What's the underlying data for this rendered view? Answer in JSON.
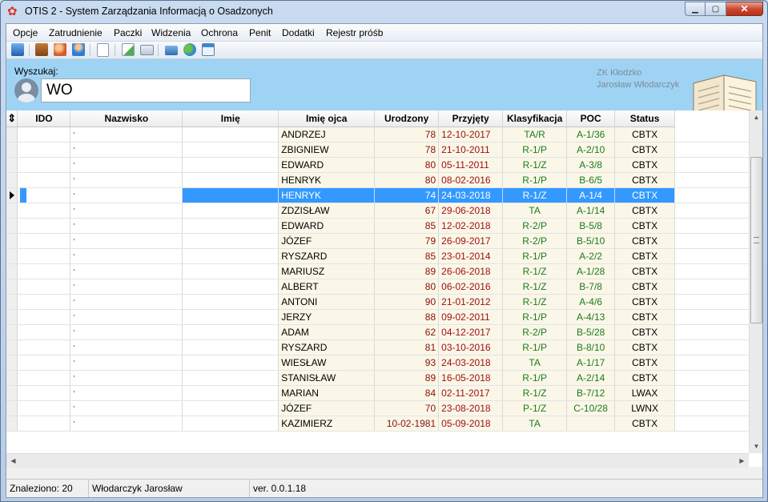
{
  "window": {
    "title": "OTIS 2 - System Zarządzania Informacją o Osadzonych",
    "buttons": {
      "minimize": "▁",
      "maximize": "▢",
      "close": "✕"
    }
  },
  "menu": [
    "Opcje",
    "Zatrudnienie",
    "Paczki",
    "Widzenia",
    "Ochrona",
    "Penit",
    "Dodatki",
    "Rejestr próśb"
  ],
  "toolbar_icons": [
    "database-icon",
    "briefcase-icon",
    "people-icon",
    "user-icon",
    "document-icon",
    "add-page-icon",
    "id-card-icon",
    "cart-icon",
    "users-group-icon",
    "calendar-icon"
  ],
  "search": {
    "label": "Wyszukaj:",
    "value": "WO"
  },
  "unit_info": {
    "line1": "ZK Kłodzko",
    "line2": "Jarosław Włodarczyk"
  },
  "grid": {
    "columns": [
      "IDO",
      "Nazwisko",
      "Imię",
      "Imię ojca",
      "Urodzony",
      "Przyjęty",
      "Klasyfikacja",
      "POC",
      "Status"
    ],
    "selected_index": 4,
    "rows": [
      {
        "ido": "'",
        "ojca": "ANDRZEJ",
        "uro": "78",
        "prz": "12-10-2017",
        "kla": "TA/R",
        "poc": "A-1/36",
        "sta": "CBTX"
      },
      {
        "ido": "'",
        "ojca": "ZBIGNIEW",
        "uro": "78",
        "prz": "21-10-2011",
        "kla": "R-1/P",
        "poc": "A-2/10",
        "sta": "CBTX"
      },
      {
        "ido": "'",
        "ojca": "EDWARD",
        "uro": "80",
        "prz": "05-11-2011",
        "kla": "R-1/Z",
        "poc": "A-3/8",
        "sta": "CBTX"
      },
      {
        "ido": "'",
        "ojca": "HENRYK",
        "uro": "80",
        "prz": "08-02-2016",
        "kla": "R-1/P",
        "poc": "B-6/5",
        "sta": "CBTX"
      },
      {
        "ido": "'",
        "ojca": "HENRYK",
        "uro": "74",
        "prz": "24-03-2018",
        "kla": "R-1/Z",
        "poc": "A-1/4",
        "sta": "CBTX"
      },
      {
        "ido": "'",
        "ojca": "ZDZISŁAW",
        "uro": "67",
        "prz": "29-06-2018",
        "kla": "TA",
        "poc": "A-1/14",
        "sta": "CBTX"
      },
      {
        "ido": "'",
        "ojca": "EDWARD",
        "uro": "85",
        "prz": "12-02-2018",
        "kla": "R-2/P",
        "poc": "B-5/8",
        "sta": "CBTX"
      },
      {
        "ido": "'",
        "ojca": "JÓZEF",
        "uro": "79",
        "prz": "26-09-2017",
        "kla": "R-2/P",
        "poc": "B-5/10",
        "sta": "CBTX"
      },
      {
        "ido": "'",
        "ojca": "RYSZARD",
        "uro": "85",
        "prz": "23-01-2014",
        "kla": "R-1/P",
        "poc": "A-2/2",
        "sta": "CBTX"
      },
      {
        "ido": "'",
        "ojca": "MARIUSZ",
        "uro": "89",
        "prz": "26-06-2018",
        "kla": "R-1/Z",
        "poc": "A-1/28",
        "sta": "CBTX"
      },
      {
        "ido": "'",
        "ojca": "ALBERT",
        "uro": "80",
        "prz": "06-02-2016",
        "kla": "R-1/Z",
        "poc": "B-7/8",
        "sta": "CBTX"
      },
      {
        "ido": "'",
        "ojca": "ANTONI",
        "uro": "90",
        "prz": "21-01-2012",
        "kla": "R-1/Z",
        "poc": "A-4/6",
        "sta": "CBTX"
      },
      {
        "ido": "'",
        "ojca": "JERZY",
        "uro": "88",
        "prz": "09-02-2011",
        "kla": "R-1/P",
        "poc": "A-4/13",
        "sta": "CBTX"
      },
      {
        "ido": "'",
        "ojca": "ADAM",
        "uro": "62",
        "prz": "04-12-2017",
        "kla": "R-2/P",
        "poc": "B-5/28",
        "sta": "CBTX"
      },
      {
        "ido": "'",
        "ojca": "RYSZARD",
        "uro": "81",
        "prz": "03-10-2016",
        "kla": "R-1/P",
        "poc": "B-8/10",
        "sta": "CBTX"
      },
      {
        "ido": "'",
        "ojca": "WIESŁAW",
        "uro": "93",
        "prz": "24-03-2018",
        "kla": "TA",
        "poc": "A-1/17",
        "sta": "CBTX"
      },
      {
        "ido": "'",
        "ojca": "STANISŁAW",
        "uro": "89",
        "prz": "16-05-2018",
        "kla": "R-1/P",
        "poc": "A-2/14",
        "sta": "CBTX"
      },
      {
        "ido": "'",
        "ojca": "MARIAN",
        "uro": "84",
        "prz": "02-11-2017",
        "kla": "R-1/Z",
        "poc": "B-7/12",
        "sta": "LWAX"
      },
      {
        "ido": "'",
        "ojca": "JÓZEF",
        "uro": "70",
        "prz": "23-08-2018",
        "kla": "P-1/Z",
        "poc": "C-10/28",
        "sta": "LWNX"
      },
      {
        "ido": "'",
        "ojca": "KAZIMIERZ",
        "uro": "10-02-1981",
        "prz": "05-09-2018",
        "kla": "TA",
        "poc": "",
        "sta": "CBTX"
      }
    ]
  },
  "status": {
    "found": "Znaleziono: 20",
    "user": "Włodarczyk Jarosław",
    "version": "ver. 0.0.1.18"
  }
}
